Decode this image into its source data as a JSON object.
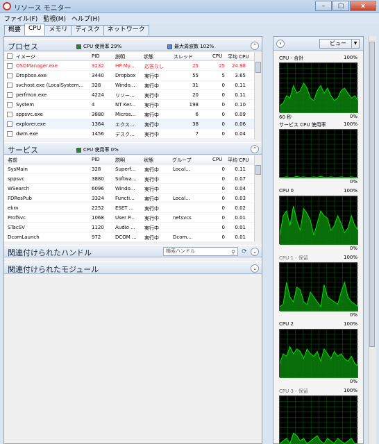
{
  "window": {
    "title": "リソース モニター",
    "btn_min": "–",
    "btn_max": "□",
    "btn_close": "x"
  },
  "menu": [
    "ファイル(F)",
    "監視(M)",
    "ヘルプ(H)"
  ],
  "tabs": [
    "概要",
    "CPU",
    "メモリ",
    "ディスク",
    "ネットワーク"
  ],
  "processes": {
    "title": "プロセス",
    "legend1": "CPU 使用率 29%",
    "legend2": "最大周波数 102%",
    "columns": [
      "イメージ",
      "PID",
      "説明",
      "状態",
      "スレッド",
      "CPU",
      "平均 CPU"
    ],
    "rows": [
      {
        "name": "OSDManager.exe",
        "pid": "3232",
        "desc": "HP My...",
        "state": "応答なし",
        "threads": "25",
        "cpu": "25",
        "avg": "24.98",
        "red": true
      },
      {
        "name": "Dropbox.exe",
        "pid": "3440",
        "desc": "Dropbox",
        "state": "実行中",
        "threads": "55",
        "cpu": "5",
        "avg": "3.65"
      },
      {
        "name": "svchost.exe (LocalSystem...",
        "pid": "328",
        "desc": "Windo...",
        "state": "実行中",
        "threads": "31",
        "cpu": "0",
        "avg": "0.11"
      },
      {
        "name": "perfmon.exe",
        "pid": "4224",
        "desc": "リソー...",
        "state": "実行中",
        "threads": "20",
        "cpu": "0",
        "avg": "0.11"
      },
      {
        "name": "System",
        "pid": "4",
        "desc": "NT Ker...",
        "state": "実行中",
        "threads": "198",
        "cpu": "0",
        "avg": "0.10"
      },
      {
        "name": "sppsvc.exe",
        "pid": "3880",
        "desc": "Micros...",
        "state": "実行中",
        "threads": "6",
        "cpu": "0",
        "avg": "0.09"
      },
      {
        "name": "explorer.exe",
        "pid": "1364",
        "desc": "エクス...",
        "state": "実行中",
        "threads": "38",
        "cpu": "0",
        "avg": "0.06"
      },
      {
        "name": "dwm.exe",
        "pid": "1456",
        "desc": "デスク...",
        "state": "実行中",
        "threads": "7",
        "cpu": "0",
        "avg": "0.04"
      }
    ]
  },
  "services": {
    "title": "サービス",
    "legend1": "CPU 使用率 0%",
    "columns": [
      "名前",
      "PID",
      "説明",
      "状態",
      "グループ",
      "CPU",
      "平均 CPU"
    ],
    "rows": [
      {
        "name": "SysMain",
        "pid": "328",
        "desc": "Superf...",
        "state": "実行中",
        "group": "Local...",
        "cpu": "0",
        "avg": "0.11"
      },
      {
        "name": "sppsvc",
        "pid": "3880",
        "desc": "Softwa...",
        "state": "実行中",
        "group": "",
        "cpu": "0",
        "avg": "0.07"
      },
      {
        "name": "WSearch",
        "pid": "6096",
        "desc": "Windo...",
        "state": "実行中",
        "group": "",
        "cpu": "0",
        "avg": "0.04"
      },
      {
        "name": "FDResPub",
        "pid": "3324",
        "desc": "Functi...",
        "state": "実行中",
        "group": "Local...",
        "cpu": "0",
        "avg": "0.03"
      },
      {
        "name": "ekrn",
        "pid": "2252",
        "desc": "ESET ...",
        "state": "実行中",
        "group": "",
        "cpu": "0",
        "avg": "0.02"
      },
      {
        "name": "ProfSvc",
        "pid": "1068",
        "desc": "User P...",
        "state": "実行中",
        "group": "netsvcs",
        "cpu": "0",
        "avg": "0.01"
      },
      {
        "name": "STacSV",
        "pid": "1120",
        "desc": "Audio ...",
        "state": "実行中",
        "group": "",
        "cpu": "0",
        "avg": "0.01"
      },
      {
        "name": "DcomLaunch",
        "pid": "972",
        "desc": "DCOM ...",
        "state": "実行中",
        "group": "Dcom...",
        "cpu": "0",
        "avg": "0.01"
      }
    ]
  },
  "handles": {
    "title": "関連付けられたハンドル",
    "search_placeholder": "検索ハンドル"
  },
  "modules": {
    "title": "関連付けられたモジュール"
  },
  "right": {
    "view_label": "ビュー",
    "graphs": [
      {
        "title": "CPU - 合計",
        "max": "100%",
        "sub_left": "60 秒",
        "sub_right": "0%",
        "dim": false
      },
      {
        "title": "サービス CPU 使用率",
        "max": "100%",
        "sub_right": "0%",
        "dim": false
      },
      {
        "title": "CPU 0",
        "max": "100%",
        "sub_right": "0%",
        "dim": false
      },
      {
        "title": "CPU 1 - 保留",
        "max": "100%",
        "sub_right": "0%",
        "dim": true
      },
      {
        "title": "CPU 2",
        "max": "100%",
        "sub_right": "0%",
        "dim": false
      },
      {
        "title": "CPU 3 - 保留",
        "max": "100%",
        "sub_right": "",
        "dim": true
      }
    ]
  },
  "colors": {
    "cpu_legend": "#1f8a1f",
    "freq_legend": "#4a8de0",
    "graph_line": "#00e000",
    "graph_fill": "#0a7a0a",
    "grid": "#0a5a0a"
  }
}
